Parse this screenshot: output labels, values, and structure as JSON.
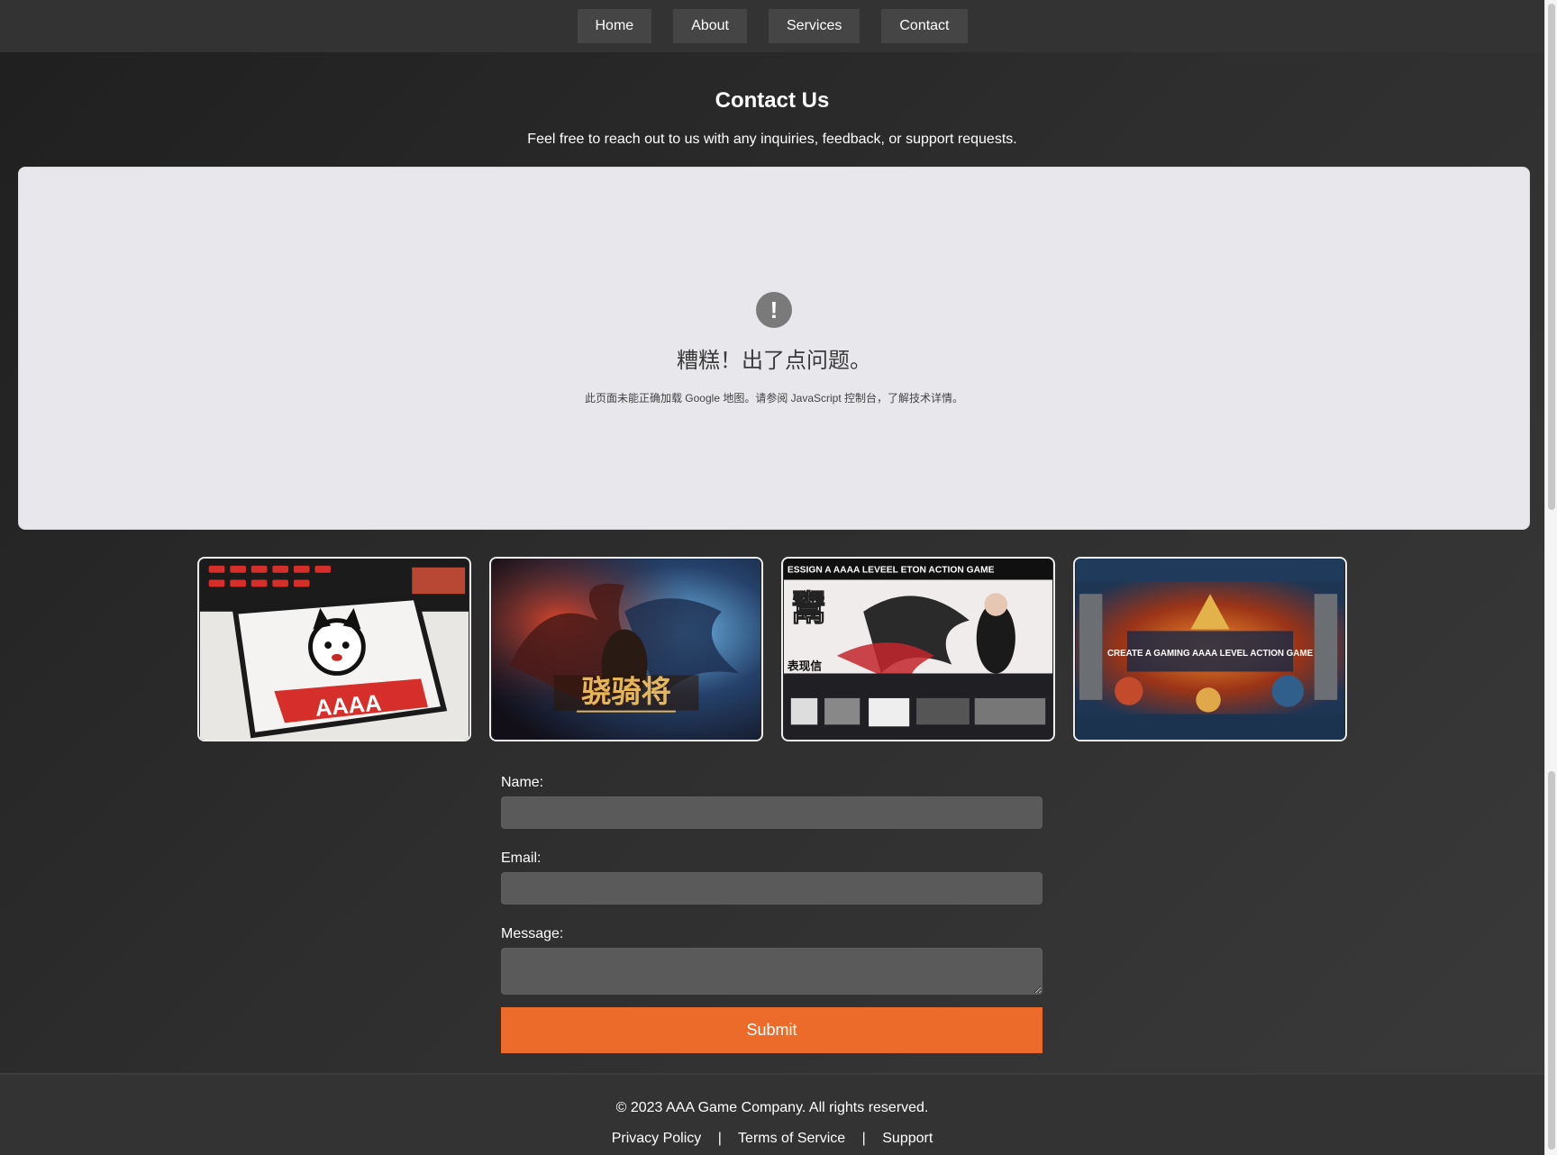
{
  "nav": {
    "items": [
      {
        "label": "Home"
      },
      {
        "label": "About"
      },
      {
        "label": "Services"
      },
      {
        "label": "Contact"
      }
    ]
  },
  "header": {
    "title": "Contact Us",
    "subtitle": "Feel free to reach out to us with any inquiries, feedback, or support requests."
  },
  "map": {
    "icon": "alert-circle-icon",
    "heading": "糟糕！出了点问题。",
    "message": "此页面未能正确加载 Google 地图。请参阅 JavaScript 控制台，了解技术详情。"
  },
  "gallery": {
    "images": [
      {
        "label": "AAAA"
      },
      {
        "label": "骁骑将"
      },
      {
        "label": "ESSIGN  A AAAA LEVEEL  ETON ACTION GAME"
      },
      {
        "label": "CREATE A GAMING AAAA LEVEL ACTION GAME"
      }
    ]
  },
  "form": {
    "name_label": "Name:",
    "name_value": "",
    "email_label": "Email:",
    "email_value": "",
    "message_label": "Message:",
    "message_value": "",
    "submit_label": "Submit"
  },
  "footer": {
    "copyright": "© 2023 AAA Game Company. All rights reserved.",
    "links": [
      {
        "label": "Privacy Policy"
      },
      {
        "label": "Terms of Service"
      },
      {
        "label": "Support"
      }
    ],
    "separator": "|"
  },
  "colors": {
    "accent": "#ec6b2a",
    "nav_bg": "#333333",
    "map_bg": "#e8e8ec"
  }
}
